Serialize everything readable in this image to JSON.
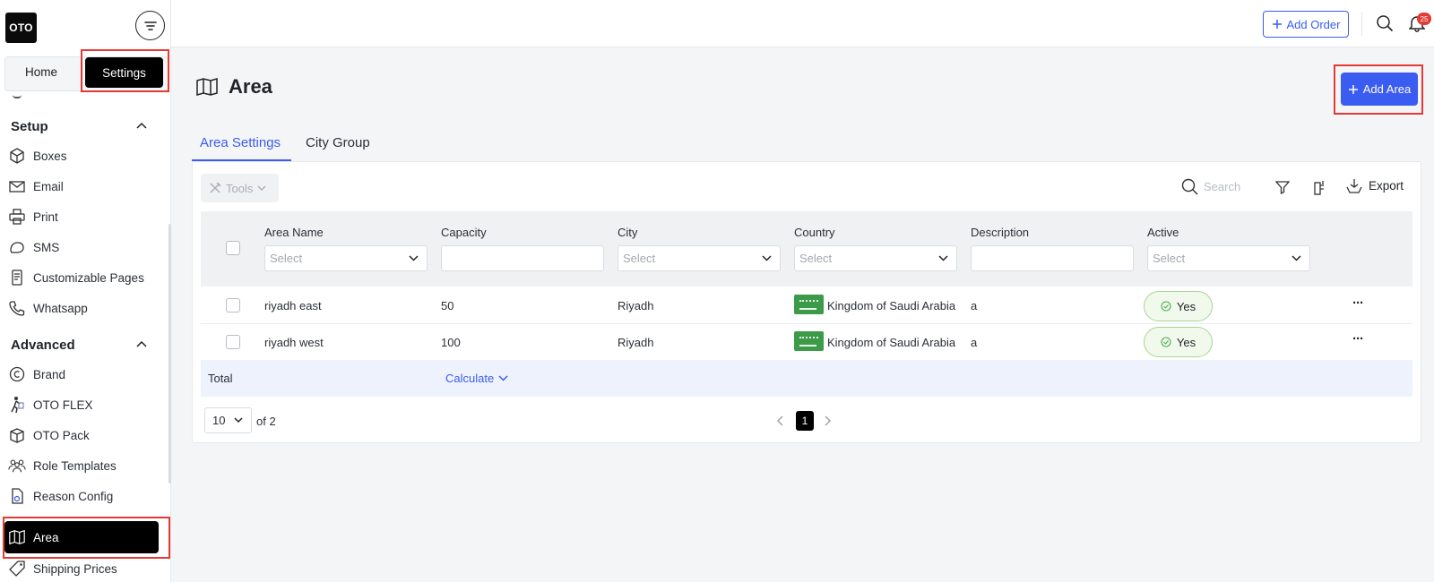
{
  "app": {
    "logo": "OTO"
  },
  "sidebar": {
    "switch": {
      "home": "Home",
      "settings": "Settings"
    },
    "sections": [
      {
        "title": "Setup",
        "items": [
          {
            "label": "Boxes",
            "icon": "box-icon"
          },
          {
            "label": "Email",
            "icon": "envelope-icon"
          },
          {
            "label": "Print",
            "icon": "printer-icon"
          },
          {
            "label": "SMS",
            "icon": "chat-icon"
          },
          {
            "label": "Customizable Pages",
            "icon": "page-icon"
          },
          {
            "label": "Whatsapp",
            "icon": "phone-icon"
          }
        ]
      },
      {
        "title": "Advanced",
        "items": [
          {
            "label": "Brand",
            "icon": "copyright-icon"
          },
          {
            "label": "OTO FLEX",
            "icon": "walker-icon"
          },
          {
            "label": "OTO Pack",
            "icon": "package-icon"
          },
          {
            "label": "Role Templates",
            "icon": "users-icon"
          },
          {
            "label": "Reason Config",
            "icon": "file-gear-icon"
          },
          {
            "label": "Area",
            "icon": "map-icon",
            "active": true
          },
          {
            "label": "Shipping Prices",
            "icon": "tag-icon"
          }
        ]
      }
    ]
  },
  "topbar": {
    "add_order": "Add Order",
    "notification_count": "25"
  },
  "page": {
    "title": "Area",
    "add_button": "Add Area"
  },
  "tabs": [
    {
      "label": "Area Settings",
      "active": true
    },
    {
      "label": "City Group"
    }
  ],
  "toolbar": {
    "tools": "Tools",
    "search_placeholder": "Search",
    "export": "Export"
  },
  "table": {
    "columns": [
      {
        "label": "Area Name",
        "filter": "Select",
        "type": "select"
      },
      {
        "label": "Capacity",
        "filter": "",
        "type": "text"
      },
      {
        "label": "City",
        "filter": "Select",
        "type": "select"
      },
      {
        "label": "Country",
        "filter": "Select",
        "type": "select"
      },
      {
        "label": "Description",
        "filter": "",
        "type": "text"
      },
      {
        "label": "Active",
        "filter": "Select",
        "type": "select"
      }
    ],
    "rows": [
      {
        "area_name": "riyadh east",
        "capacity": "50",
        "city": "Riyadh",
        "country": "Kingdom of Saudi Arabia",
        "description": "a",
        "active": "Yes"
      },
      {
        "area_name": "riyadh west",
        "capacity": "100",
        "city": "Riyadh",
        "country": "Kingdom of Saudi Arabia",
        "description": "a",
        "active": "Yes"
      }
    ],
    "total_label": "Total",
    "calculate": "Calculate"
  },
  "pagination": {
    "page_size": "10",
    "of_label": "of 2",
    "current_page": "1"
  },
  "colors": {
    "accent": "#3b5cf0",
    "highlight": "#e53935",
    "active_bg": "#000000"
  }
}
